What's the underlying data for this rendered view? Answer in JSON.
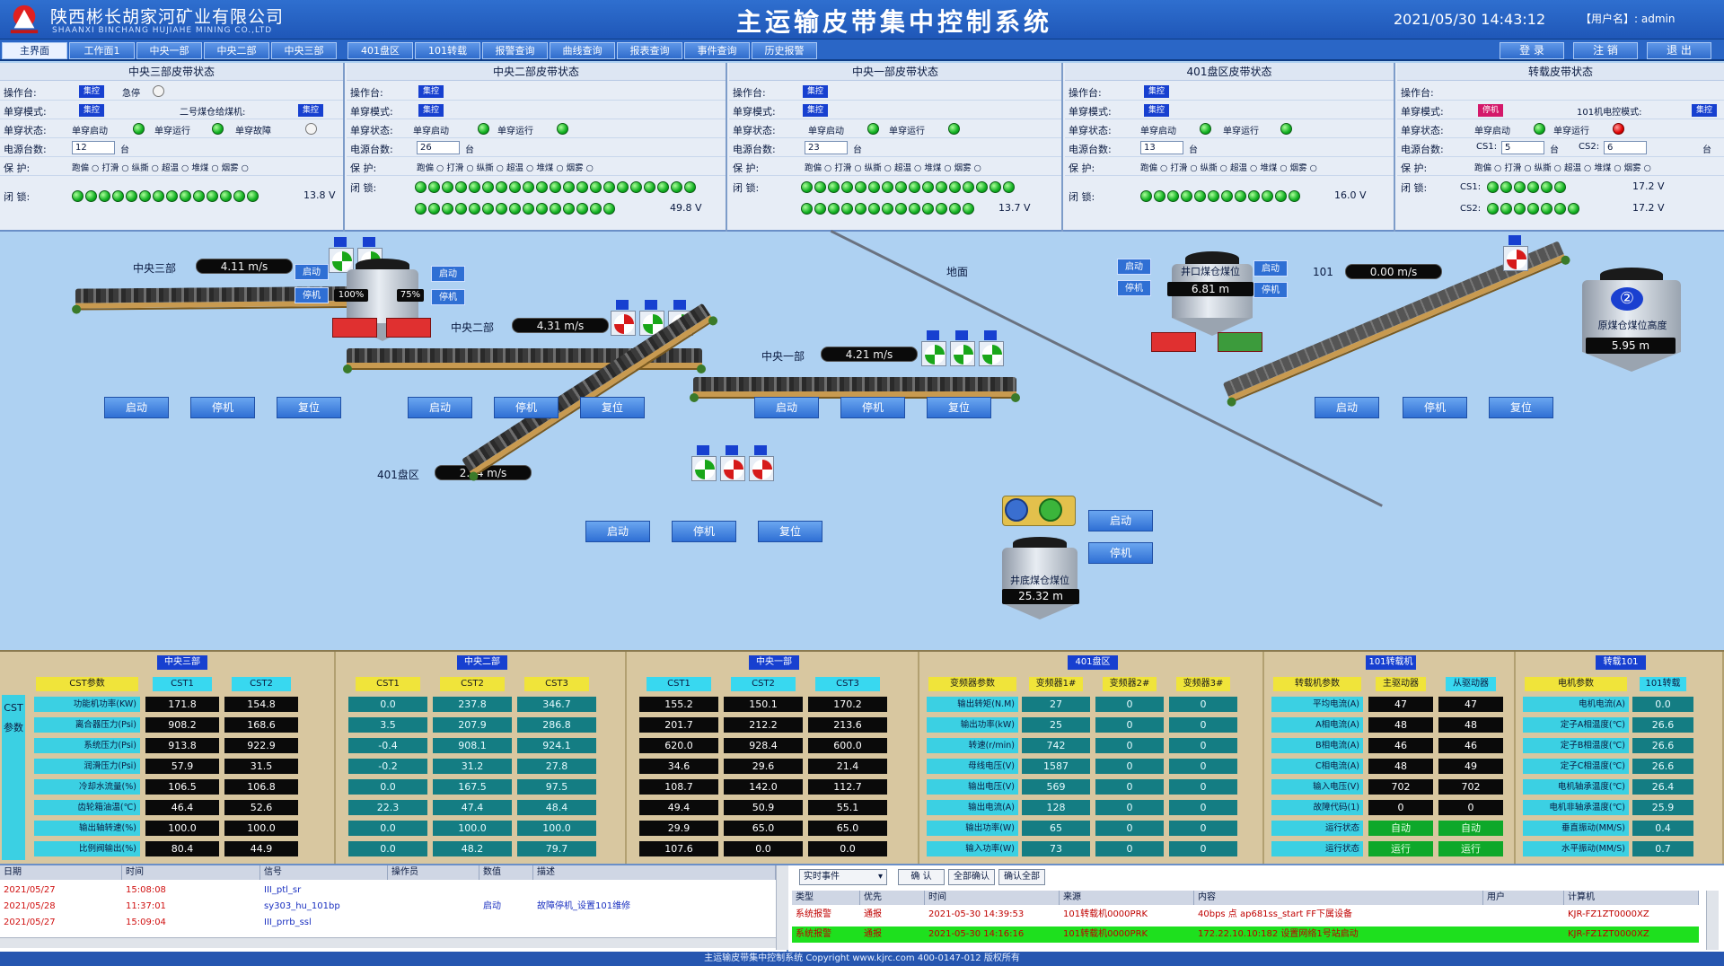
{
  "header": {
    "company": "陕西彬长胡家河矿业有限公司",
    "company_en": "SHAANXI BINCHANG HUJIAHE MINING CO.,LTD",
    "title": "主运输皮带集中控制系统",
    "datetime": "2021/05/30 14:43:12",
    "user": "【用户名】: admin"
  },
  "menu": [
    "主界面",
    "工作面1",
    "中央一部",
    "中央二部",
    "中央三部",
    "401盘区",
    "101转载",
    "报警查询",
    "曲线查询",
    "报表查询",
    "事件查询",
    "历史报警"
  ],
  "right_buttons": [
    "登 录",
    "注 销",
    "退 出"
  ],
  "status_panels": [
    {
      "title": "中央三部皮带状态",
      "op": "操作台:",
      "op_val": "集控",
      "mode_label": "单穿模式:",
      "mode_val": "集控",
      "extra": "急停",
      "state_label": "单穿状态:",
      "states": [
        "单穿启动",
        "单穿运行",
        "单穿故障"
      ],
      "motor_label": "电源台数:",
      "motor_val": "12",
      "motor_unit": "台",
      "protect_label": "保    护:",
      "protects": "跑偏 ○ 打滑 ○ 纵撕 ○ 超温 ○ 堆煤 ○ 烟雾 ○",
      "lock_label": "闭    锁:",
      "volt": "13.8 V"
    },
    {
      "title": "中央二部皮带状态",
      "op": "操作台:",
      "op_val": "集控",
      "mode_label": "单穿模式:",
      "mode_val": "集控",
      "extra": "",
      "state_label": "单穿状态:",
      "states": [
        "单穿启动",
        "单穿运行"
      ],
      "motor_label": "电源台数:",
      "motor_val": "26",
      "motor_unit": "台",
      "protect_label": "保    护:",
      "protects": "跑偏 ○ 打滑 ○ 纵撕 ○ 超温 ○ 堆煤 ○ 烟雾 ○",
      "lock_label": "闭    锁:",
      "volt": "49.8 V"
    },
    {
      "title": "中央一部皮带状态",
      "op": "操作台:",
      "op_val": "集控",
      "mode_label": "单穿模式:",
      "mode_val": "集控",
      "extra": "",
      "state_label": "单穿状态:",
      "states": [
        "单穿启动",
        "单穿运行"
      ],
      "motor_label": "电源台数:",
      "motor_val": "23",
      "motor_unit": "台",
      "protect_label": "保    护:",
      "protects": "跑偏 ○ 打滑 ○ 纵撕 ○ 超温 ○ 堆煤 ○ 烟雾 ○",
      "lock_label": "闭    锁:",
      "volt": "13.7 V"
    },
    {
      "title": "401盘区皮带状态",
      "op": "操作台:",
      "op_val": "集控",
      "mode_label": "单穿模式:",
      "mode_val": "集控",
      "extra": "",
      "state_label": "单穿状态:",
      "states": [
        "单穿启动",
        "单穿运行"
      ],
      "motor_label": "电源台数:",
      "motor_val": "13",
      "motor_unit": "台",
      "protect_label": "保    护:",
      "protects": "跑偏 ○ 打滑 ○ 纵撕 ○ 超温 ○ 堆煤 ○ 烟雾 ○",
      "lock_label": "闭    锁:",
      "volt": "16.0 V"
    },
    {
      "title": "转载皮带状态",
      "op": "操作台:",
      "op_val": "",
      "mode_label": "单穿模式:",
      "mode_val": "停机",
      "extra": "101机电控模式:",
      "state_label": "单穿状态:",
      "states": [
        "单穿启动",
        "单穿运行"
      ],
      "motor_label": "电源台数:",
      "motor_val": "CS1:",
      "motor_unit": "台",
      "motor_val2": "5",
      "motor_val3": "CS2:",
      "motor_val4": "6",
      "protect_label": "保    护:",
      "protects": "跑偏 ○ 打滑 ○ 纵撕 ○ 超温 ○ 堆煤 ○ 烟雾 ○",
      "lock_label": "闭    锁:",
      "volt": "17.2 V",
      "cs1": "CS1:",
      "cs2": "CS2:",
      "volt2": "17.2 V"
    }
  ],
  "process": {
    "belt3_label": "中央三部",
    "belt3_speed": "4.11  m/s",
    "belt2_label": "中央二部",
    "belt2_speed": "4.31  m/s",
    "belt1_label": "中央一部",
    "belt1_speed": "4.21  m/s",
    "belt401_label": "401盘区",
    "belt401_speed": "2.24  m/s",
    "belt101_label": "101",
    "belt101_speed": "0.00  m/s",
    "ground_label": "地面",
    "silo_mid_pct_left": "100%",
    "silo_mid_pct_right": "75%",
    "silo_mid_start": "启动",
    "silo_mid_stop": "停机",
    "silo_mid_start_r": "启动",
    "silo_mid_stop_r": "停机",
    "silo_well_label": "井口煤仓煤位",
    "silo_well_val": "6.81  m",
    "silo_well_btns": [
      "启动",
      "启动",
      "停机",
      "停机"
    ],
    "silo_yard_label": "原煤仓煤位高度",
    "silo_yard_val": "5.95  m",
    "silo_yard_num": "②",
    "silo_lower_label": "井底煤仓煤位",
    "silo_lower_val": "25.32  m",
    "feeder_btns": [
      "启动",
      "停机"
    ],
    "ctrl_labels": [
      "启动",
      "停机",
      "复位"
    ]
  },
  "params": {
    "cst_side": "CST参数",
    "groups": [
      {
        "title": "中央三部",
        "heads": [
          "CST参数",
          "CST1",
          "CST2"
        ],
        "head_styles": [
          "y",
          "c",
          "c"
        ],
        "rows": [
          "功能机功率(KW)",
          "离合器压力(Psi)",
          "系统压力(Psi)",
          "润滑压力(Psi)",
          "冷却水流量(%)",
          "齿轮箱油温(℃)",
          "输出轴转速(%)",
          "比例阀输出(%)"
        ],
        "cols": [
          [
            "171.8",
            "908.2",
            "913.8",
            "57.9",
            "106.5",
            "46.4",
            "100.0",
            "80.4"
          ],
          [
            "154.8",
            "168.6",
            "922.9",
            "31.5",
            "106.8",
            "52.6",
            "100.0",
            "44.9"
          ]
        ]
      },
      {
        "title": "中央二部",
        "heads": [
          "CST1",
          "CST2",
          "CST3"
        ],
        "head_styles": [
          "y",
          "y",
          "y"
        ],
        "cols": [
          [
            "0.0",
            "3.5",
            "-0.4",
            "-0.2",
            "0.0",
            "22.3",
            "0.0",
            "0.0"
          ],
          [
            "237.8",
            "207.9",
            "908.1",
            "31.2",
            "167.5",
            "47.4",
            "100.0",
            "48.2"
          ],
          [
            "346.7",
            "286.8",
            "924.1",
            "27.8",
            "97.5",
            "48.4",
            "100.0",
            "79.7"
          ]
        ]
      },
      {
        "title": "中央一部",
        "heads": [
          "CST1",
          "CST2",
          "CST3"
        ],
        "head_styles": [
          "c",
          "c",
          "c"
        ],
        "cols": [
          [
            "155.2",
            "201.7",
            "620.0",
            "34.6",
            "108.7",
            "49.4",
            "29.9",
            "107.6"
          ],
          [
            "150.1",
            "212.2",
            "928.4",
            "29.6",
            "142.0",
            "50.9",
            "65.0",
            "0.0"
          ],
          [
            "170.2",
            "213.6",
            "600.0",
            "21.4",
            "112.7",
            "55.1",
            "65.0",
            "0.0"
          ]
        ]
      },
      {
        "title": "401盘区",
        "heads": [
          "变频器参数",
          "变频器1#",
          "变频器2#",
          "变频器3#"
        ],
        "head_styles": [
          "y",
          "y",
          "y",
          "y"
        ],
        "rows": [
          "输出转矩(N.M)",
          "输出功率(kW)",
          "转速(r/min)",
          "母线电压(V)",
          "输出电压(V)",
          "输出电流(A)",
          "输出功率(W)",
          "输入功率(W)"
        ],
        "cols": [
          [
            "27",
            "25",
            "742",
            "1587",
            "569",
            "128",
            "65",
            "73"
          ],
          [
            "0",
            "0",
            "0",
            "0",
            "0",
            "0",
            "0",
            "0"
          ],
          [
            "0",
            "0",
            "0",
            "0",
            "0",
            "0",
            "0",
            "0"
          ]
        ]
      },
      {
        "title": "101转载机",
        "heads": [
          "转载机参数",
          "主驱动器",
          "从驱动器"
        ],
        "head_styles": [
          "y",
          "y",
          "c"
        ],
        "rows": [
          "平均电流(A)",
          "A相电流(A)",
          "B相电流(A)",
          "C相电流(A)",
          "输入电压(V)",
          "故障代码(1)",
          "运行状态",
          "运行状态"
        ],
        "cols": [
          [
            "47",
            "48",
            "46",
            "48",
            "702",
            "0",
            "自动",
            "运行"
          ],
          [
            "47",
            "48",
            "46",
            "49",
            "702",
            "0",
            "自动",
            "运行"
          ]
        ]
      },
      {
        "title": "转载101",
        "heads": [
          "电机参数",
          "101转载"
        ],
        "head_styles": [
          "y",
          "c"
        ],
        "rows": [
          "电机电流(A)",
          "定子A相温度(℃)",
          "定子B相温度(℃)",
          "定子C相温度(℃)",
          "电机轴承温度(℃)",
          "电机非轴承温度(℃)",
          "垂直振动(MM/S)",
          "水平振动(MM/S)"
        ],
        "cols": [
          [
            "0.0",
            "26.6",
            "26.6",
            "26.6",
            "26.4",
            "25.9",
            "0.4",
            "0.7"
          ]
        ]
      }
    ]
  },
  "event_log": {
    "headers": [
      "日期",
      "时间",
      "信号",
      "操作员",
      "数值",
      "描述"
    ],
    "rows": [
      [
        "2021/05/27",
        "15:08:08",
        "III_ptl_sr",
        "",
        "",
        ""
      ],
      [
        "2021/05/28",
        "11:37:01",
        "sy303_hu_101bp",
        "",
        "启动",
        "故障停机_设置101维修"
      ],
      [
        "2021/05/27",
        "15:09:04",
        "III_prrb_ssl",
        "",
        "",
        ""
      ]
    ]
  },
  "alarm_log": {
    "filter": "实时事件",
    "buttons": [
      "确 认",
      "全部确认",
      "确认全部"
    ],
    "headers": [
      "类型",
      "优先",
      "时间",
      "来源",
      "内容",
      "用户",
      "计算机"
    ],
    "rows": [
      [
        "系统报警",
        "通报",
        "2021-05-30 14:39:53",
        "101转载机0000PRK",
        "40bps 点 ap681ss_start FF下属设备",
        "",
        "KJR-FZ1ZT0000XZ"
      ],
      [
        "系统报警",
        "通报",
        "2021-05-30 14:16:16",
        "101转载机0000PRK",
        "172.22.10.10:182 设置网络1号站启动",
        "",
        "KJR-FZ1ZT0000XZ"
      ]
    ]
  },
  "footer": "主运输皮带集中控制系统 Copyright  www.kjrc.com   400-0147-012   版权所有",
  "colors": {
    "accent": "#1f57b8",
    "run": "#11b022",
    "fault": "#e00000",
    "panel_bg": "#e7edf6"
  }
}
